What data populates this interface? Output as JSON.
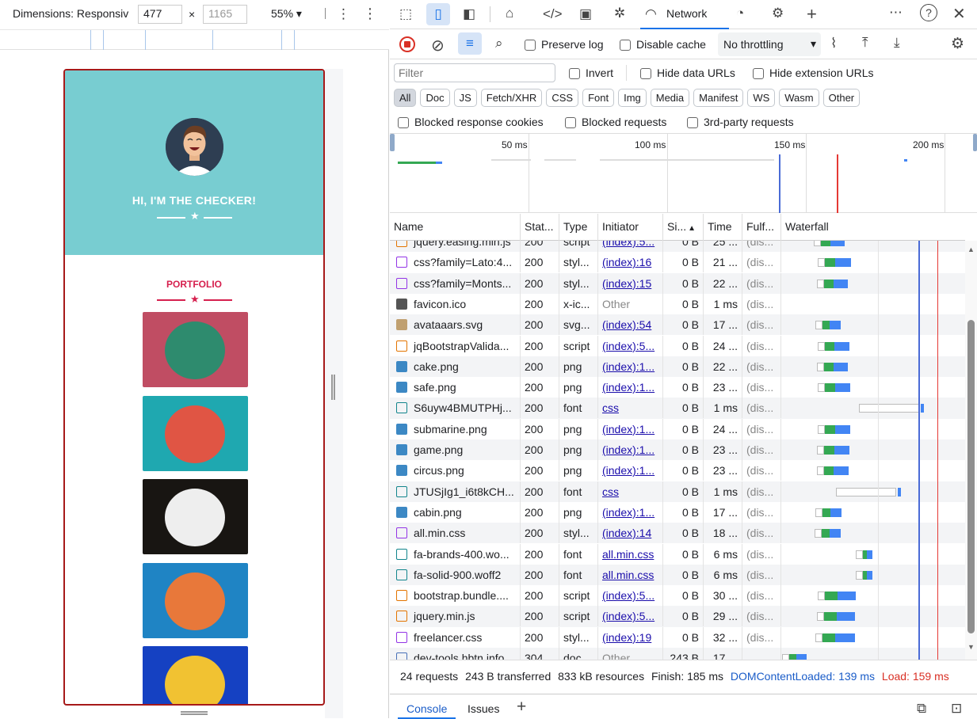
{
  "device_toolbar": {
    "dimensions_label": "Dimensions: Responsiv",
    "width": "477",
    "height_placeholder": "1165",
    "times": "×",
    "zoom": "55%"
  },
  "page": {
    "hero_title": "HI, I'M THE CHECKER!",
    "portfolio_title": "PORTFOLIO",
    "tiles": [
      {
        "name": "cabin",
        "bg": "#c04d63",
        "circle": "#2e8b6e"
      },
      {
        "name": "cake",
        "bg": "#1fa8b0",
        "circle": "#e05544"
      },
      {
        "name": "circus",
        "bg": "#181512",
        "circle": "#eeeeee"
      },
      {
        "name": "game",
        "bg": "#1f84c4",
        "circle": "#e8783a"
      },
      {
        "name": "safe",
        "bg": "#1541c2",
        "circle": "#f1c232"
      }
    ]
  },
  "devtools": {
    "tabs": {
      "network": "Network"
    },
    "toolbar": {
      "preserve_log": "Preserve log",
      "disable_cache": "Disable cache",
      "throttling": "No throttling"
    },
    "filter": {
      "placeholder": "Filter",
      "invert": "Invert",
      "hide_data_urls": "Hide data URLs",
      "hide_extension_urls": "Hide extension URLs"
    },
    "type_filters": [
      "All",
      "Doc",
      "JS",
      "Fetch/XHR",
      "CSS",
      "Font",
      "Img",
      "Media",
      "Manifest",
      "WS",
      "Wasm",
      "Other"
    ],
    "checkbox_row": {
      "blocked_cookies": "Blocked response cookies",
      "blocked_requests": "Blocked requests",
      "third_party": "3rd-party requests"
    },
    "timeline_ticks": [
      "50 ms",
      "100 ms",
      "150 ms",
      "200 ms"
    ],
    "columns": [
      "Name",
      "Stat...",
      "Type",
      "Initiator",
      "Si...",
      "Time",
      "Fulf...",
      "Waterfall"
    ],
    "rows": [
      {
        "name": "jquery.easing.min.js",
        "status": "200",
        "type": "script",
        "initiator": "(index):5...",
        "size": "0 B",
        "time": "25 ...",
        "fulfilled": "(dis...",
        "icon": "js",
        "wf": [
          50,
          80
        ],
        "init_link": true
      },
      {
        "name": "css?family=Lato:4...",
        "status": "200",
        "type": "styl...",
        "initiator": "(index):16",
        "size": "0 B",
        "time": "21 ...",
        "fulfilled": "(dis...",
        "icon": "css",
        "wf": [
          55,
          88
        ],
        "init_link": true
      },
      {
        "name": "css?family=Monts...",
        "status": "200",
        "type": "styl...",
        "initiator": "(index):15",
        "size": "0 B",
        "time": "22 ...",
        "fulfilled": "(dis...",
        "icon": "css",
        "wf": [
          54,
          84
        ],
        "init_link": true
      },
      {
        "name": "favicon.ico",
        "status": "200",
        "type": "x-ic...",
        "initiator": "Other",
        "size": "0 B",
        "time": "1 ms",
        "fulfilled": "(dis...",
        "icon": "ico",
        "wf": null,
        "init_link": false
      },
      {
        "name": "avataaars.svg",
        "status": "200",
        "type": "svg...",
        "initiator": "(index):54",
        "size": "0 B",
        "time": "17 ...",
        "fulfilled": "(dis...",
        "icon": "svg",
        "wf": [
          52,
          75
        ],
        "init_link": true
      },
      {
        "name": "jqBootstrapValida...",
        "status": "200",
        "type": "script",
        "initiator": "(index):5...",
        "size": "0 B",
        "time": "24 ...",
        "fulfilled": "(dis...",
        "icon": "js",
        "wf": [
          55,
          86
        ],
        "init_link": true
      },
      {
        "name": "cake.png",
        "status": "200",
        "type": "png",
        "initiator": "(index):1...",
        "size": "0 B",
        "time": "22 ...",
        "fulfilled": "(dis...",
        "icon": "png",
        "wf": [
          54,
          84
        ],
        "init_link": true
      },
      {
        "name": "safe.png",
        "status": "200",
        "type": "png",
        "initiator": "(index):1...",
        "size": "0 B",
        "time": "23 ...",
        "fulfilled": "(dis...",
        "icon": "png",
        "wf": [
          55,
          87
        ],
        "init_link": true
      },
      {
        "name": "S6uyw4BMUTPHj...",
        "status": "200",
        "type": "font",
        "initiator": "css",
        "size": "0 B",
        "time": "1 ms",
        "fulfilled": "(dis...",
        "icon": "font",
        "wf": [
          176,
          180
        ],
        "init_link": true
      },
      {
        "name": "submarine.png",
        "status": "200",
        "type": "png",
        "initiator": "(index):1...",
        "size": "0 B",
        "time": "24 ...",
        "fulfilled": "(dis...",
        "icon": "png",
        "wf": [
          55,
          87
        ],
        "init_link": true
      },
      {
        "name": "game.png",
        "status": "200",
        "type": "png",
        "initiator": "(index):1...",
        "size": "0 B",
        "time": "23 ...",
        "fulfilled": "(dis...",
        "icon": "png",
        "wf": [
          54,
          86
        ],
        "init_link": true
      },
      {
        "name": "circus.png",
        "status": "200",
        "type": "png",
        "initiator": "(index):1...",
        "size": "0 B",
        "time": "23 ...",
        "fulfilled": "(dis...",
        "icon": "png",
        "wf": [
          54,
          85
        ],
        "init_link": true
      },
      {
        "name": "JTUSjIg1_i6t8kCH...",
        "status": "200",
        "type": "font",
        "initiator": "css",
        "size": "0 B",
        "time": "1 ms",
        "fulfilled": "(dis...",
        "icon": "font",
        "wf": [
          147,
          151
        ],
        "init_link": true
      },
      {
        "name": "cabin.png",
        "status": "200",
        "type": "png",
        "initiator": "(index):1...",
        "size": "0 B",
        "time": "17 ...",
        "fulfilled": "(dis...",
        "icon": "png",
        "wf": [
          52,
          76
        ],
        "init_link": true
      },
      {
        "name": "all.min.css",
        "status": "200",
        "type": "styl...",
        "initiator": "(index):14",
        "size": "0 B",
        "time": "18 ...",
        "fulfilled": "(dis...",
        "icon": "css",
        "wf": [
          51,
          75
        ],
        "init_link": true
      },
      {
        "name": "fa-brands-400.wo...",
        "status": "200",
        "type": "font",
        "initiator": "all.min.css",
        "size": "0 B",
        "time": "6 ms",
        "fulfilled": "(dis...",
        "icon": "font",
        "wf": [
          103,
          115
        ],
        "init_link": true
      },
      {
        "name": "fa-solid-900.woff2",
        "status": "200",
        "type": "font",
        "initiator": "all.min.css",
        "size": "0 B",
        "time": "6 ms",
        "fulfilled": "(dis...",
        "icon": "font",
        "wf": [
          103,
          115
        ],
        "init_link": true
      },
      {
        "name": "bootstrap.bundle....",
        "status": "200",
        "type": "script",
        "initiator": "(index):5...",
        "size": "0 B",
        "time": "30 ...",
        "fulfilled": "(dis...",
        "icon": "js",
        "wf": [
          55,
          94
        ],
        "init_link": true
      },
      {
        "name": "jquery.min.js",
        "status": "200",
        "type": "script",
        "initiator": "(index):5...",
        "size": "0 B",
        "time": "29 ...",
        "fulfilled": "(dis...",
        "icon": "js",
        "wf": [
          54,
          93
        ],
        "init_link": true
      },
      {
        "name": "freelancer.css",
        "status": "200",
        "type": "styl...",
        "initiator": "(index):19",
        "size": "0 B",
        "time": "32 ...",
        "fulfilled": "(dis...",
        "icon": "css",
        "wf": [
          52,
          93
        ],
        "init_link": true
      },
      {
        "name": "dev-tools.hbtn.info",
        "status": "304",
        "type": "doc...",
        "initiator": "Other",
        "size": "243 B",
        "time": "17 ...",
        "fulfilled": "",
        "icon": "doc",
        "wf": [
          10,
          32
        ],
        "init_link": false
      }
    ],
    "status_bar": {
      "requests": "24 requests",
      "transferred": "243 B transferred",
      "resources": "833 kB resources",
      "finish": "Finish: 185 ms",
      "dcl": "DOMContentLoaded: 139 ms",
      "load": "Load: 159 ms"
    },
    "drawer": {
      "console": "Console",
      "issues": "Issues"
    }
  }
}
